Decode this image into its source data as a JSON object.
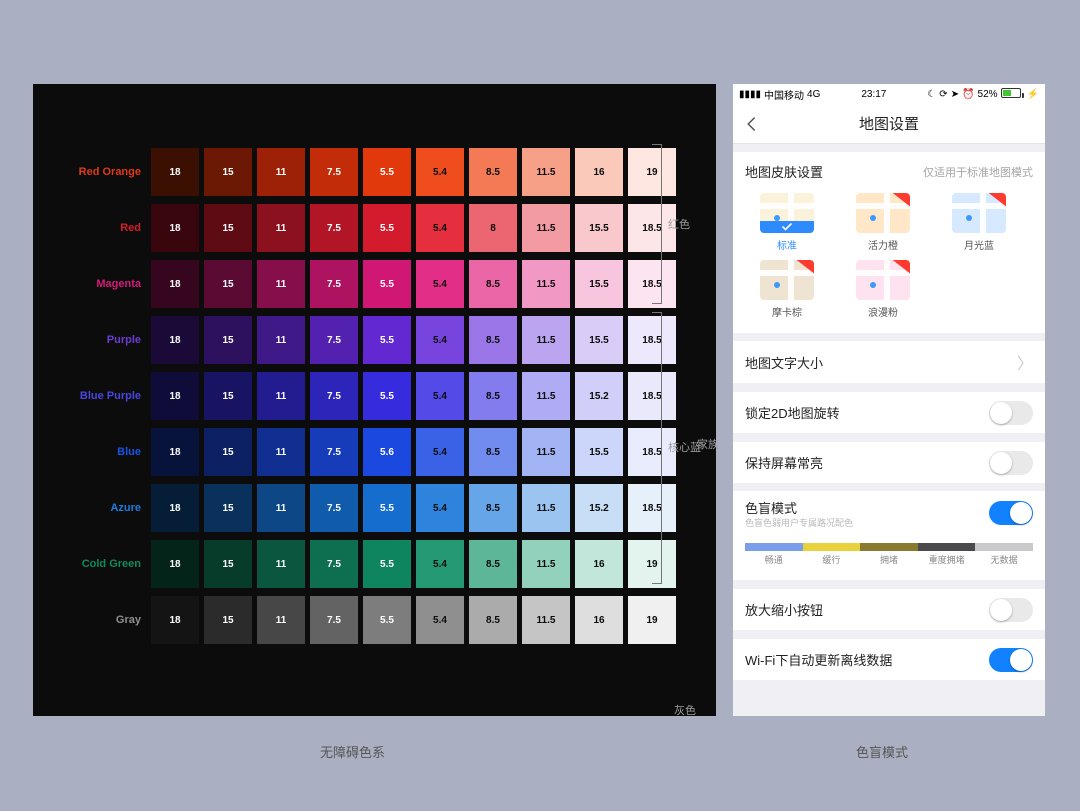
{
  "captions": {
    "left": "无障碍色系",
    "right": "色盲模式"
  },
  "sideGroups": {
    "red": "红色",
    "coreBlue": "核心蓝",
    "family": "家族",
    "gray": "灰色"
  },
  "palette": {
    "rows": [
      {
        "name": "Red Orange",
        "labelColor": "#e03a1b",
        "cells": [
          {
            "v": "18",
            "bg": "#3c0f03",
            "fg": "#ffffff"
          },
          {
            "v": "15",
            "bg": "#6b1805",
            "fg": "#ffffff"
          },
          {
            "v": "11",
            "bg": "#9c2107",
            "fg": "#ffffff"
          },
          {
            "v": "7.5",
            "bg": "#c32c09",
            "fg": "#ffffff"
          },
          {
            "v": "5.5",
            "bg": "#e2390c",
            "fg": "#ffffff"
          },
          {
            "v": "5.4",
            "bg": "#ef4d1d",
            "fg": "#0c0c0c"
          },
          {
            "v": "8.5",
            "bg": "#f37a55",
            "fg": "#0c0c0c"
          },
          {
            "v": "11.5",
            "bg": "#f7a088",
            "fg": "#0c0c0c"
          },
          {
            "v": "16",
            "bg": "#fbc9ba",
            "fg": "#0c0c0c"
          },
          {
            "v": "19",
            "bg": "#fde7e0",
            "fg": "#0c0c0c"
          }
        ]
      },
      {
        "name": "Red",
        "labelColor": "#d81b2a",
        "cells": [
          {
            "v": "18",
            "bg": "#38060c",
            "fg": "#ffffff"
          },
          {
            "v": "15",
            "bg": "#5f0b14",
            "fg": "#ffffff"
          },
          {
            "v": "11",
            "bg": "#8c111e",
            "fg": "#ffffff"
          },
          {
            "v": "7.5",
            "bg": "#b21626",
            "fg": "#ffffff"
          },
          {
            "v": "5.5",
            "bg": "#d41b2d",
            "fg": "#ffffff"
          },
          {
            "v": "5.4",
            "bg": "#e52f3f",
            "fg": "#0c0c0c"
          },
          {
            "v": "8",
            "bg": "#ec6672",
            "fg": "#0c0c0c"
          },
          {
            "v": "11.5",
            "bg": "#f29ba3",
            "fg": "#0c0c0c"
          },
          {
            "v": "15.5",
            "bg": "#f8c8cd",
            "fg": "#0c0c0c"
          },
          {
            "v": "18.5",
            "bg": "#fce6e8",
            "fg": "#0c0c0c"
          }
        ]
      },
      {
        "name": "Magenta",
        "labelColor": "#d61a77",
        "cells": [
          {
            "v": "18",
            "bg": "#36061e",
            "fg": "#ffffff"
          },
          {
            "v": "15",
            "bg": "#5b0a33",
            "fg": "#ffffff"
          },
          {
            "v": "11",
            "bg": "#860f4b",
            "fg": "#ffffff"
          },
          {
            "v": "7.5",
            "bg": "#ad1360",
            "fg": "#ffffff"
          },
          {
            "v": "5.5",
            "bg": "#cf1773",
            "fg": "#ffffff"
          },
          {
            "v": "5.4",
            "bg": "#e22e87",
            "fg": "#0c0c0c"
          },
          {
            "v": "8.5",
            "bg": "#ea66a6",
            "fg": "#0c0c0c"
          },
          {
            "v": "11.5",
            "bg": "#f199c4",
            "fg": "#0c0c0c"
          },
          {
            "v": "15.5",
            "bg": "#f7c6de",
            "fg": "#0c0c0c"
          },
          {
            "v": "18.5",
            "bg": "#fce5f0",
            "fg": "#0c0c0c"
          }
        ]
      },
      {
        "name": "Purple",
        "labelColor": "#6c3bd4",
        "cells": [
          {
            "v": "18",
            "bg": "#1b0a38",
            "fg": "#ffffff"
          },
          {
            "v": "15",
            "bg": "#2d115e",
            "fg": "#ffffff"
          },
          {
            "v": "11",
            "bg": "#401988",
            "fg": "#ffffff"
          },
          {
            "v": "7.5",
            "bg": "#5221af",
            "fg": "#ffffff"
          },
          {
            "v": "5.5",
            "bg": "#6228d1",
            "fg": "#ffffff"
          },
          {
            "v": "5.4",
            "bg": "#7844de",
            "fg": "#0c0c0c"
          },
          {
            "v": "8.5",
            "bg": "#9a76e8",
            "fg": "#0c0c0c"
          },
          {
            "v": "11.5",
            "bg": "#bca5f0",
            "fg": "#0c0c0c"
          },
          {
            "v": "15.5",
            "bg": "#d9cdf7",
            "fg": "#0c0c0c"
          },
          {
            "v": "18.5",
            "bg": "#ede8fb",
            "fg": "#0c0c0c"
          }
        ]
      },
      {
        "name": "Blue Purple",
        "labelColor": "#4a44e0",
        "cells": [
          {
            "v": "18",
            "bg": "#0f0c3a",
            "fg": "#ffffff"
          },
          {
            "v": "15",
            "bg": "#191363",
            "fg": "#ffffff"
          },
          {
            "v": "11",
            "bg": "#231c91",
            "fg": "#ffffff"
          },
          {
            "v": "7.5",
            "bg": "#2d24ba",
            "fg": "#ffffff"
          },
          {
            "v": "5.5",
            "bg": "#362cde",
            "fg": "#ffffff"
          },
          {
            "v": "5.4",
            "bg": "#534ae7",
            "fg": "#0c0c0c"
          },
          {
            "v": "8.5",
            "bg": "#837cee",
            "fg": "#0c0c0c"
          },
          {
            "v": "11.5",
            "bg": "#afabf4",
            "fg": "#0c0c0c"
          },
          {
            "v": "15.2",
            "bg": "#d1cff9",
            "fg": "#0c0c0c"
          },
          {
            "v": "18.5",
            "bg": "#eae9fc",
            "fg": "#0c0c0c"
          }
        ]
      },
      {
        "name": "Blue",
        "labelColor": "#1a52e6",
        "cells": [
          {
            "v": "18",
            "bg": "#07133a",
            "fg": "#ffffff"
          },
          {
            "v": "15",
            "bg": "#0c2063",
            "fg": "#ffffff"
          },
          {
            "v": "11",
            "bg": "#112f91",
            "fg": "#ffffff"
          },
          {
            "v": "7.5",
            "bg": "#163cba",
            "fg": "#ffffff"
          },
          {
            "v": "5.6",
            "bg": "#1b48de",
            "fg": "#ffffff"
          },
          {
            "v": "5.4",
            "bg": "#3a62e7",
            "fg": "#0c0c0c"
          },
          {
            "v": "8.5",
            "bg": "#718cef",
            "fg": "#0c0c0c"
          },
          {
            "v": "11.5",
            "bg": "#a3b4f5",
            "fg": "#0c0c0c"
          },
          {
            "v": "15.5",
            "bg": "#ccd5fa",
            "fg": "#0c0c0c"
          },
          {
            "v": "18.5",
            "bg": "#e8ecfd",
            "fg": "#0c0c0c"
          }
        ]
      },
      {
        "name": "Azure",
        "labelColor": "#1b7de0",
        "cells": [
          {
            "v": "18",
            "bg": "#051d36",
            "fg": "#ffffff"
          },
          {
            "v": "15",
            "bg": "#09315c",
            "fg": "#ffffff"
          },
          {
            "v": "11",
            "bg": "#0d4786",
            "fg": "#ffffff"
          },
          {
            "v": "7.5",
            "bg": "#115bac",
            "fg": "#ffffff"
          },
          {
            "v": "5.5",
            "bg": "#156dce",
            "fg": "#ffffff"
          },
          {
            "v": "5.4",
            "bg": "#2e83dd",
            "fg": "#0c0c0c"
          },
          {
            "v": "8.5",
            "bg": "#66a5e7",
            "fg": "#0c0c0c"
          },
          {
            "v": "11.5",
            "bg": "#9bc5f0",
            "fg": "#0c0c0c"
          },
          {
            "v": "15.2",
            "bg": "#c8def7",
            "fg": "#0c0c0c"
          },
          {
            "v": "18.5",
            "bg": "#e6f0fb",
            "fg": "#0c0c0c"
          }
        ]
      },
      {
        "name": "Cold Green",
        "labelColor": "#0f8a5a",
        "cells": [
          {
            "v": "18",
            "bg": "#042319",
            "fg": "#ffffff"
          },
          {
            "v": "15",
            "bg": "#073b2a",
            "fg": "#ffffff"
          },
          {
            "v": "11",
            "bg": "#0a563e",
            "fg": "#ffffff"
          },
          {
            "v": "7.5",
            "bg": "#0d6f50",
            "fg": "#ffffff"
          },
          {
            "v": "5.5",
            "bg": "#0f855f",
            "fg": "#ffffff"
          },
          {
            "v": "5.4",
            "bg": "#259973",
            "fg": "#0c0c0c"
          },
          {
            "v": "8.5",
            "bg": "#5cb697",
            "fg": "#0c0c0c"
          },
          {
            "v": "11.5",
            "bg": "#92d1bb",
            "fg": "#0c0c0c"
          },
          {
            "v": "16",
            "bg": "#c2e6d9",
            "fg": "#0c0c0c"
          },
          {
            "v": "19",
            "bg": "#e3f4ee",
            "fg": "#0c0c0c"
          }
        ]
      },
      {
        "name": "Gray",
        "labelColor": "#8f8f8f",
        "cells": [
          {
            "v": "18",
            "bg": "#141414",
            "fg": "#ffffff"
          },
          {
            "v": "15",
            "bg": "#2b2b2b",
            "fg": "#ffffff"
          },
          {
            "v": "11",
            "bg": "#474747",
            "fg": "#ffffff"
          },
          {
            "v": "7.5",
            "bg": "#636363",
            "fg": "#ffffff"
          },
          {
            "v": "5.5",
            "bg": "#7d7d7d",
            "fg": "#ffffff"
          },
          {
            "v": "5.4",
            "bg": "#8f8f8f",
            "fg": "#0c0c0c"
          },
          {
            "v": "8.5",
            "bg": "#ababab",
            "fg": "#0c0c0c"
          },
          {
            "v": "11.5",
            "bg": "#c5c5c5",
            "fg": "#0c0c0c"
          },
          {
            "v": "16",
            "bg": "#dedede",
            "fg": "#0c0c0c"
          },
          {
            "v": "19",
            "bg": "#f0f0f0",
            "fg": "#0c0c0c"
          }
        ]
      }
    ]
  },
  "phone": {
    "status": {
      "carrier": "中国移动",
      "net": "4G",
      "time": "23:17",
      "battery": "52%"
    },
    "nav": {
      "title": "地图设置"
    },
    "skin": {
      "title": "地图皮肤设置",
      "sub": "仅适用于标准地图模式",
      "items": [
        {
          "name": "标准",
          "selected": true,
          "ribbon": false,
          "bg": "#faf2da"
        },
        {
          "name": "活力橙",
          "selected": false,
          "ribbon": true,
          "bg": "#ffe7c8"
        },
        {
          "name": "月光蓝",
          "selected": false,
          "ribbon": true,
          "bg": "#d6e9ff"
        },
        {
          "name": "摩卡棕",
          "selected": false,
          "ribbon": true,
          "bg": "#efe3d2"
        },
        {
          "name": "浪漫粉",
          "selected": false,
          "ribbon": true,
          "bg": "#ffe2ef"
        }
      ]
    },
    "rows": {
      "textSize": "地图文字大小",
      "lock2d": "锁定2D地图旋转",
      "keepOn": "保持屏幕常亮",
      "colorBlind": {
        "title": "色盲模式",
        "sub": "色盲色弱用户专属路况配色",
        "on": true
      },
      "zoom": "放大缩小按钮",
      "wifi": {
        "title": "Wi-Fi下自动更新离线数据",
        "on": true
      }
    },
    "traffic": {
      "colors": [
        "#7b9eea",
        "#e8d13a",
        "#8a7a2f",
        "#4a4a4d",
        "#c9c9cc"
      ],
      "labels": [
        "畅通",
        "缓行",
        "拥堵",
        "重度拥堵",
        "无数据"
      ]
    }
  }
}
